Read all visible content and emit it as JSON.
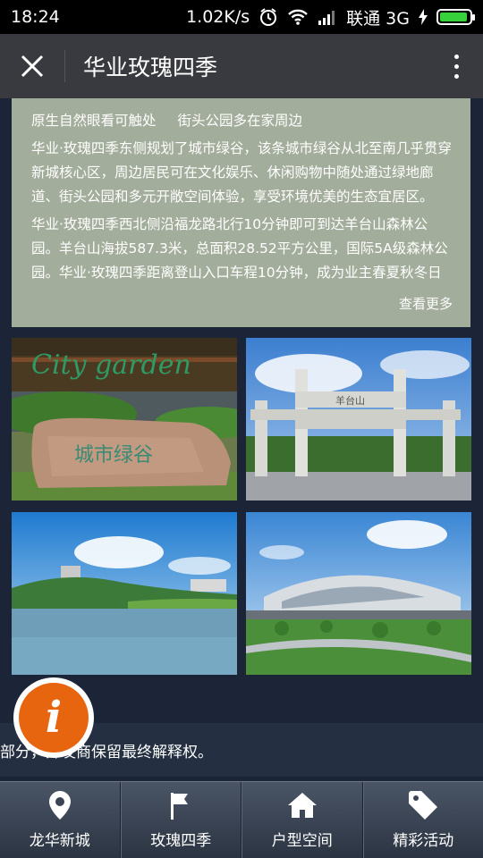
{
  "status_bar": {
    "time": "18:24",
    "speed": "1.02K/s",
    "carrier": "联通 3G",
    "battery_level": 0.95
  },
  "header": {
    "title": "华业玫瑰四季"
  },
  "intro": {
    "subtitle_a": "原生自然眼看可触处",
    "subtitle_b": "街头公园多在家周边",
    "paragraph1": "华业·玫瑰四季东侧规划了城市绿谷，该条城市绿谷从北至南几乎贯穿新城核心区，周边居民可在文化娱乐、休闲购物中随处通过绿地廊道、街头公园和多元开敞空间体验，享受环境优美的生态宜居区。",
    "paragraph2": "华业·玫瑰四季西北侧沿福龙路北行10分钟即可到达羊台山森林公园。羊台山海拔587.3米，总面积28.52平方公里，国际5A级森林公园。华业·玫瑰四季距离登山入口车程10分钟，成为业主春夏秋冬日",
    "read_more": "查看更多"
  },
  "gallery": {
    "photo1_sign_text": "City garden",
    "photo1_stone_text": "城市绿谷",
    "photo2_plaque": "羊台山"
  },
  "notice": {
    "text": "部分，开发商保留最终解释权。"
  },
  "info_button": {
    "glyph": "i"
  },
  "colors": {
    "accent": "#e8650f",
    "card_bg": "#a3ad9b",
    "page_bg": "#1b2537"
  },
  "nav": {
    "items": [
      {
        "label": "龙华新城",
        "icon": "location-pin-icon"
      },
      {
        "label": "玫瑰四季",
        "icon": "flag-icon"
      },
      {
        "label": "户型空间",
        "icon": "home-icon"
      },
      {
        "label": "精彩活动",
        "icon": "tag-icon"
      }
    ]
  }
}
